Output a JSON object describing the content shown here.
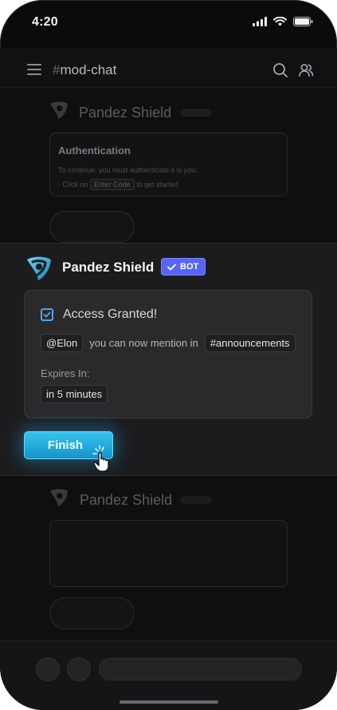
{
  "status_bar": {
    "time": "4:20"
  },
  "header": {
    "hash": "#",
    "channel": "mod-chat"
  },
  "ghost_top": {
    "name": "Pandez Shield",
    "card_title": "Authentication",
    "line1": "To continue, you must authenticate it is you.",
    "line2_prefix": "Click on",
    "line2_code": "Enter Code",
    "line2_suffix": "to get started"
  },
  "message": {
    "bot_name": "Pandez Shield",
    "badge": "BOT",
    "embed": {
      "title": "Access Granted!",
      "mention": "@Elon",
      "text": "you can now mention in",
      "channel": "#announcements",
      "expires_label": "Expires In:",
      "expires_value": "in 5 minutes"
    },
    "button": "Finish"
  },
  "ghost_bottom": {
    "name": "Pandez Shield"
  },
  "colors": {
    "accent": "#5865f2",
    "button": "#1fa7dc",
    "check": "#5aa0e8"
  }
}
